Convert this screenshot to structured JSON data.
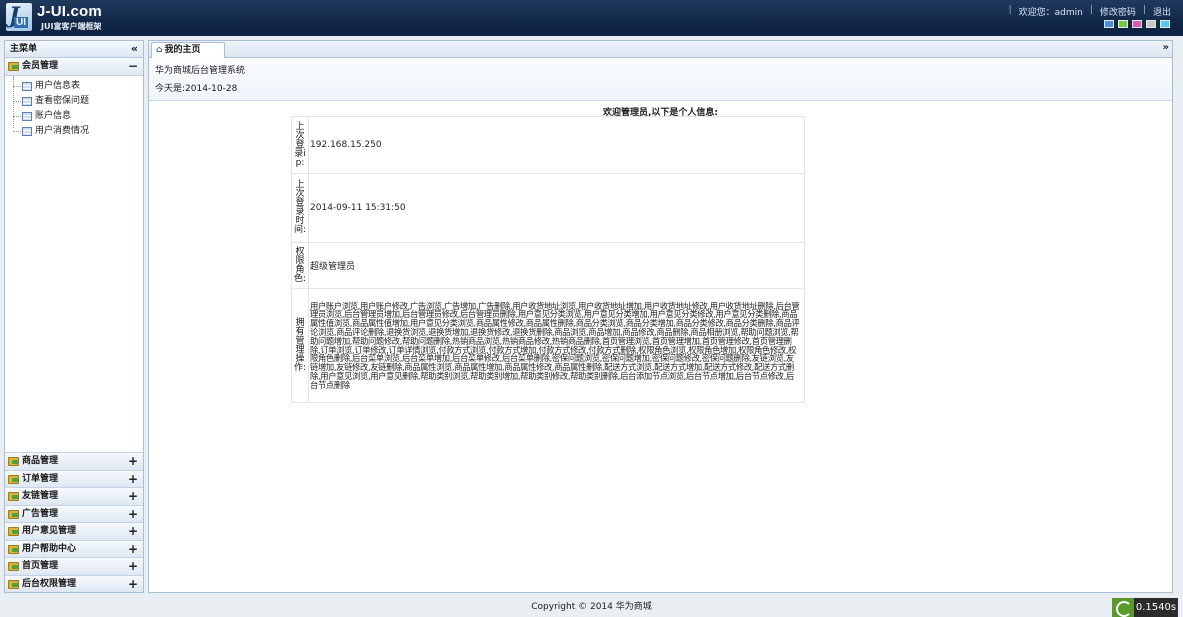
{
  "brand": {
    "title": "J-UI.com",
    "subtitle": "JUI富客户端框架",
    "mark_letter": "J",
    "mark_text": "UI"
  },
  "top_nav": {
    "welcome": "欢迎您：admin",
    "change_password": "修改密码",
    "logout": "退出",
    "separator": "|",
    "themes": [
      "#4a8fd8",
      "#7ac943",
      "#e05aa9",
      "#c8c8c8",
      "#5cc8e8"
    ]
  },
  "sidebar": {
    "title": "主菜单",
    "collapse_icon": "«",
    "expanded_section": {
      "label": "会员管理",
      "toggle": "−",
      "items": [
        {
          "label": "用户信息表"
        },
        {
          "label": "查看密保问题"
        },
        {
          "label": "账户信息"
        },
        {
          "label": "用户消费情况"
        }
      ]
    },
    "collapsed_sections": [
      {
        "label": "商品管理",
        "toggle": "+"
      },
      {
        "label": "订单管理",
        "toggle": "+"
      },
      {
        "label": "友链管理",
        "toggle": "+"
      },
      {
        "label": "广告管理",
        "toggle": "+"
      },
      {
        "label": "用户意见管理",
        "toggle": "+"
      },
      {
        "label": "用户帮助中心",
        "toggle": "+"
      },
      {
        "label": "首页管理",
        "toggle": "+"
      },
      {
        "label": "后台权限管理",
        "toggle": "+"
      }
    ]
  },
  "tabs": {
    "home_icon": "⌂",
    "home_label": "我的主页",
    "menu_icon": "»"
  },
  "info": {
    "system_name": "华为商城后台管理系统",
    "today": "今天是:2014-10-28"
  },
  "profile": {
    "heading": "欢迎管理员,以下是个人信息:",
    "rows": [
      {
        "key": "上次登录ip:",
        "value": "192.168.15.250"
      },
      {
        "key": "上次登录时间:",
        "value": "2014-09-11 15:31:50"
      },
      {
        "key": "权限角色:",
        "value": "超级管理员"
      },
      {
        "key": "拥有管理操作:",
        "value": "用户账户浏览,用户账户修改,广告浏览,广告增加,广告删除,用户收货地址浏览,用户收货地址增加,用户收货地址修改,用户收货地址删除,后台管理员浏览,后台管理员增加,后台管理员修改,后台管理员删除,用户意见分类浏览,用户意见分类增加,用户意见分类修改,用户意见分类删除,商品属性值浏览,商品属性值增加,用户意见分类浏览,商品属性修改,商品属性删除,商品分类浏览,商品分类增加,商品分类修改,商品分类删除,商品评论浏览,商品评论删除,退换货浏览,退换货增加,退换货修改,退换货删除,商品浏览,商品增加,商品修改,商品删除,商品相册浏览,帮助问题浏览,帮助问题增加,帮助问题修改,帮助问题删除,热销商品浏览,热销商品修改,热销商品删除,首页管理浏览,首页管理增加,首页管理修改,首页管理删除,订单浏览,订单修改,订单详情浏览,付款方式浏览,付款方式增加,付款方式修改,付款方式删除,权限角色浏览,权限角色增加,权限角色修改,权限角色删除,后台菜单浏览,后台菜单增加,后台菜单修改,后台菜单删除,密保问题浏览,密保问题增加,密保问题修改,密保问题删除,友链浏览,友链增加,友链修改,友链删除,商品属性浏览,商品属性增加,商品属性修改,商品属性删除,配送方式浏览,配送方式增加,配送方式修改,配送方式删除,用户意见浏览,用户意见删除,帮助类别浏览,帮助类别增加,帮助类别修改,帮助类别删除,后台添加节点浏览,后台节点增加,后台节点修改,后台节点删除"
      }
    ]
  },
  "footer": {
    "copyright": "Copyright © 2014 华为商城",
    "timer": "0.1540s"
  }
}
